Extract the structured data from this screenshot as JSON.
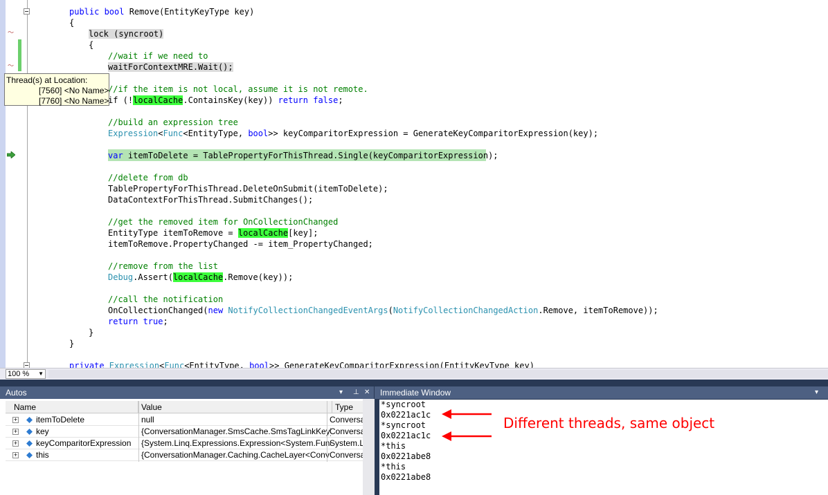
{
  "editor": {
    "lines": [
      [
        {
          "t": "public ",
          "c": "kw"
        },
        {
          "t": "bool ",
          "c": "kw"
        },
        {
          "t": "Remove(EntityKeyType key)"
        }
      ],
      [
        {
          "t": "{"
        }
      ],
      [
        {
          "t": "lock (syncroot)",
          "c": "gray"
        }
      ],
      [
        {
          "t": "{"
        }
      ],
      [
        {
          "t": "//wait if we need to",
          "c": "cm"
        }
      ],
      [
        {
          "t": "waitForContextMRE.Wait();",
          "c": "gray"
        }
      ],
      [],
      [
        {
          "t": "//if the item is not local, assume it is not remote.",
          "c": "cm"
        }
      ],
      [
        {
          "t": "if (!"
        },
        {
          "t": "localCache",
          "c": "hl"
        },
        {
          "t": ".ContainsKey(key)) "
        },
        {
          "t": "return ",
          "c": "kw"
        },
        {
          "t": "false",
          "c": "kw"
        },
        {
          "t": ";"
        }
      ],
      [],
      [
        {
          "t": "//build an expression tree",
          "c": "cm"
        }
      ],
      [
        {
          "t": "Expression",
          "c": "ty"
        },
        {
          "t": "<"
        },
        {
          "t": "Func",
          "c": "ty"
        },
        {
          "t": "<EntityType, "
        },
        {
          "t": "bool",
          "c": "kw"
        },
        {
          "t": ">> keyComparitorExpression = GenerateKeyComparitorExpression(key);"
        }
      ],
      [],
      [
        {
          "t": "var ",
          "c": "kw"
        },
        {
          "t": "itemToDelete = TablePropertyForThisThread.Single(keyComparitorExpression);"
        }
      ],
      [],
      [
        {
          "t": "//delete from db",
          "c": "cm"
        }
      ],
      [
        {
          "t": "TablePropertyForThisThread.DeleteOnSubmit(itemToDelete);"
        }
      ],
      [
        {
          "t": "DataContextForThisThread.SubmitChanges();"
        }
      ],
      [],
      [
        {
          "t": "//get the removed item for OnCollectionChanged",
          "c": "cm"
        }
      ],
      [
        {
          "t": "EntityType itemToRemove = "
        },
        {
          "t": "localCache",
          "c": "hl"
        },
        {
          "t": "[key];"
        }
      ],
      [
        {
          "t": "itemToRemove.PropertyChanged -= item_PropertyChanged;"
        }
      ],
      [],
      [
        {
          "t": "//remove from the list",
          "c": "cm"
        }
      ],
      [
        {
          "t": "Debug",
          "c": "ty"
        },
        {
          "t": ".Assert("
        },
        {
          "t": "localCache",
          "c": "hl"
        },
        {
          "t": ".Remove(key));"
        }
      ],
      [],
      [
        {
          "t": "//call the notification",
          "c": "cm"
        }
      ],
      [
        {
          "t": "OnCollectionChanged("
        },
        {
          "t": "new ",
          "c": "kw"
        },
        {
          "t": "NotifyCollectionChangedEventArgs",
          "c": "ty"
        },
        {
          "t": "("
        },
        {
          "t": "NotifyCollectionChangedAction",
          "c": "ty"
        },
        {
          "t": ".Remove, itemToRemove));"
        }
      ],
      [
        {
          "t": "return ",
          "c": "kw"
        },
        {
          "t": "true",
          "c": "kw"
        },
        {
          "t": ";"
        }
      ],
      [
        {
          "t": "}"
        }
      ],
      [
        {
          "t": "}"
        }
      ],
      [],
      [
        {
          "t": "private ",
          "c": "kw"
        },
        {
          "t": "Expression",
          "c": "ty"
        },
        {
          "t": "<"
        },
        {
          "t": "Func",
          "c": "ty"
        },
        {
          "t": "<EntityType, "
        },
        {
          "t": "bool",
          "c": "kw"
        },
        {
          "t": ">> GenerateKeyComparitorExpression(EntityKeyType key)"
        }
      ]
    ],
    "indents": [
      100,
      100,
      128,
      128,
      156,
      156,
      0,
      156,
      156,
      0,
      156,
      156,
      0,
      156,
      0,
      156,
      156,
      156,
      0,
      156,
      156,
      156,
      0,
      156,
      156,
      0,
      156,
      156,
      156,
      128,
      100,
      0,
      100
    ]
  },
  "tooltip": {
    "title": "Thread(s) at Location:",
    "threads": [
      "[7560] <No Name>",
      "[7760] <No Name>"
    ]
  },
  "zoom": {
    "value": "100 %"
  },
  "autos": {
    "title": "Autos",
    "columns": {
      "name": "Name",
      "value": "Value",
      "type": "Type"
    },
    "rows": [
      {
        "name": "itemToDelete",
        "value": "null",
        "type": "Conversa"
      },
      {
        "name": "key",
        "value": "{ConversationManager.SmsCache.SmsTagLinkKey}",
        "type": "Conversa"
      },
      {
        "name": "keyComparitorExpression",
        "value": "{System.Linq.Expressions.Expression<System.Func<",
        "type": "System.L"
      },
      {
        "name": "this",
        "value": "{ConversationManager.Caching.CacheLayer<Conv",
        "type": "Conversa"
      }
    ]
  },
  "immediate": {
    "title": "Immediate Window",
    "lines": [
      "*syncroot",
      "0x0221ac1c",
      "*syncroot",
      "0x0221ac1c",
      "*this",
      "0x0221abe8",
      "*this",
      "0x0221abe8"
    ]
  },
  "annotation": "Different threads, same object",
  "colors": {
    "annotation": "#ff0000",
    "highlight": "#3cff3c",
    "panel_title": "#4d6082"
  }
}
